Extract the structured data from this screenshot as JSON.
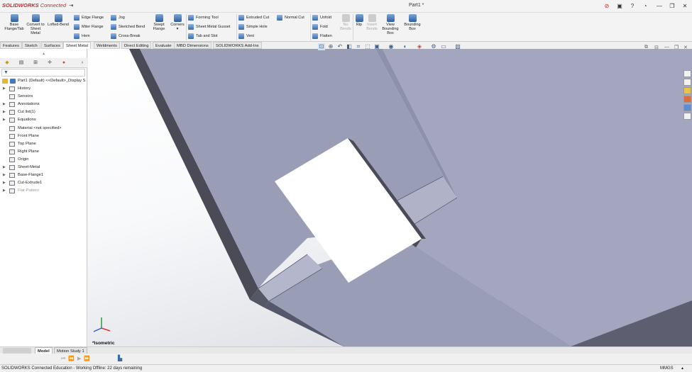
{
  "app": {
    "logo_main": "SOLIDWORKS",
    "logo_sub": "Connected",
    "window_title": "Part1 *"
  },
  "ribbon": {
    "large": [
      {
        "label": "Base Flange/Tab"
      },
      {
        "label": "Convert to Sheet Metal"
      },
      {
        "label": "Lofted-Bend"
      },
      {
        "label": "Swept Flange"
      },
      {
        "label": "Corners"
      },
      {
        "label": "Rip"
      },
      {
        "label": "Insert Bends"
      },
      {
        "label": "View Bounding Box"
      },
      {
        "label": "Bounding Box"
      },
      {
        "label": "No Bends"
      }
    ],
    "rows": {
      "edge_flange": "Edge Flange",
      "miter_flange": "Miter Flange",
      "hem": "Hem",
      "jog": "Jog",
      "sketched_bend": "Sketched Bend",
      "cross_break": "Cross-Break",
      "forming_tool": "Forming Tool",
      "gusset": "Sheet Metal Gusset",
      "tab_slot": "Tab and Slot",
      "extruded_cut": "Extruded Cut",
      "simple_hole": "Simple Hole",
      "vent": "Vent",
      "normal_cut": "Normal Cut",
      "unfold": "Unfold",
      "fold": "Fold",
      "flatten": "Flatten"
    }
  },
  "tabs": [
    "Features",
    "Sketch",
    "Surfaces",
    "Sheet Metal",
    "Weldments",
    "Direct Editing",
    "Evaluate",
    "MBD Dimensions",
    "SOLIDWORKS Add-Ins"
  ],
  "active_tab": "Sheet Metal",
  "tree": {
    "root": "Part1 (Default) <<Default>_Display S",
    "items": [
      {
        "label": "History",
        "arrow": true
      },
      {
        "label": "Sensors",
        "arrow": false
      },
      {
        "label": "Annotations",
        "arrow": true
      },
      {
        "label": "Cut list(1)",
        "arrow": true
      },
      {
        "label": "Equations",
        "arrow": true
      },
      {
        "label": "Material <not specified>",
        "arrow": false
      },
      {
        "label": "Front Plane",
        "arrow": false
      },
      {
        "label": "Top Plane",
        "arrow": false
      },
      {
        "label": "Right Plane",
        "arrow": false
      },
      {
        "label": "Origin",
        "arrow": false
      },
      {
        "label": "Sheet-Metal",
        "arrow": true
      },
      {
        "label": "Base-Flange1",
        "arrow": true
      },
      {
        "label": "Cut-Extrude1",
        "arrow": true
      },
      {
        "label": "Flat-Pattern",
        "arrow": true
      }
    ]
  },
  "viewport": {
    "view_name": "*Isometric"
  },
  "bottom_tabs": [
    "Model",
    "Motion Study 1"
  ],
  "status": {
    "left": "SOLIDWORKS Connected Education - Working Offline: 22 days remaining",
    "units": "MMGS"
  },
  "colors": {
    "sheet_face": "#9a9db6",
    "sheet_edge": "#4a4b57",
    "accent": "#c62828"
  }
}
